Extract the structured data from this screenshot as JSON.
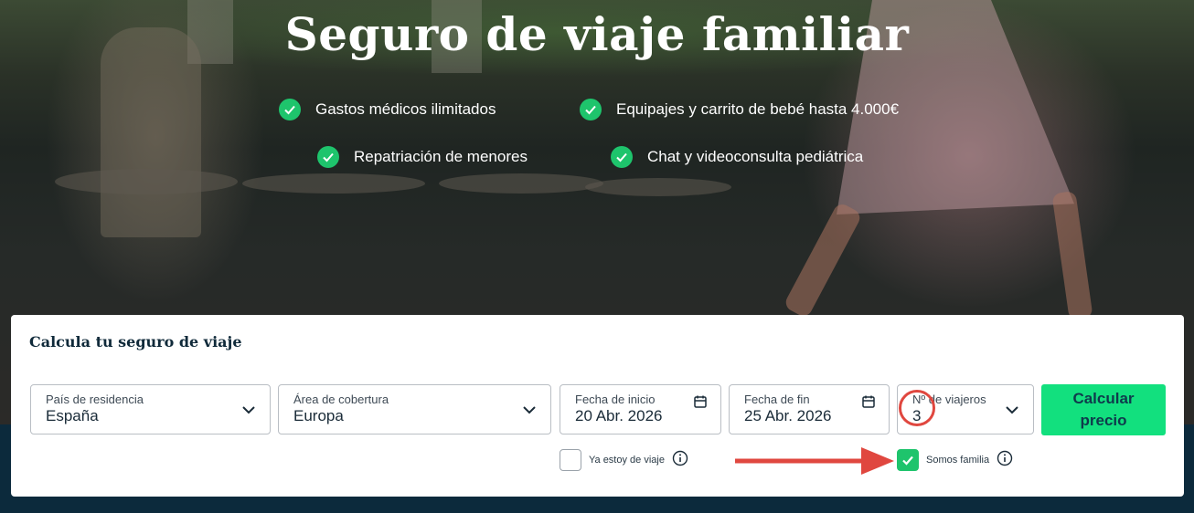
{
  "hero": {
    "title": "Seguro de viaje familiar",
    "features": [
      "Gastos médicos ilimitados",
      "Equipajes y carrito de bebé hasta 4.000€",
      "Repatriación de menores",
      "Chat y videoconsulta pediátrica"
    ]
  },
  "calculator": {
    "title": "Calcula tu seguro de viaje",
    "fields": {
      "residence": {
        "label": "País de residencia",
        "value": "España"
      },
      "coverage": {
        "label": "Área de cobertura",
        "value": "Europa"
      },
      "start_date": {
        "label": "Fecha de inicio",
        "value": "20 Abr. 2026"
      },
      "end_date": {
        "label": "Fecha de fin",
        "value": "25 Abr. 2026"
      },
      "travelers": {
        "label": "Nº de viajeros",
        "value": "3"
      }
    },
    "submit_label_line1": "Calcular",
    "submit_label_line2": "precio",
    "options": {
      "already_traveling": {
        "label": "Ya estoy de viaje",
        "checked": false
      },
      "family": {
        "label": "Somos familia",
        "checked": true
      }
    }
  },
  "icons": [
    "check-icon",
    "chevron-down-icon",
    "calendar-icon",
    "info-icon",
    "arrow-right-icon"
  ],
  "colors": {
    "accent_green": "#12e07e",
    "check_green": "#1ec46c",
    "annotation_red": "#e0473f",
    "footer_navy": "#0c2a3c"
  }
}
